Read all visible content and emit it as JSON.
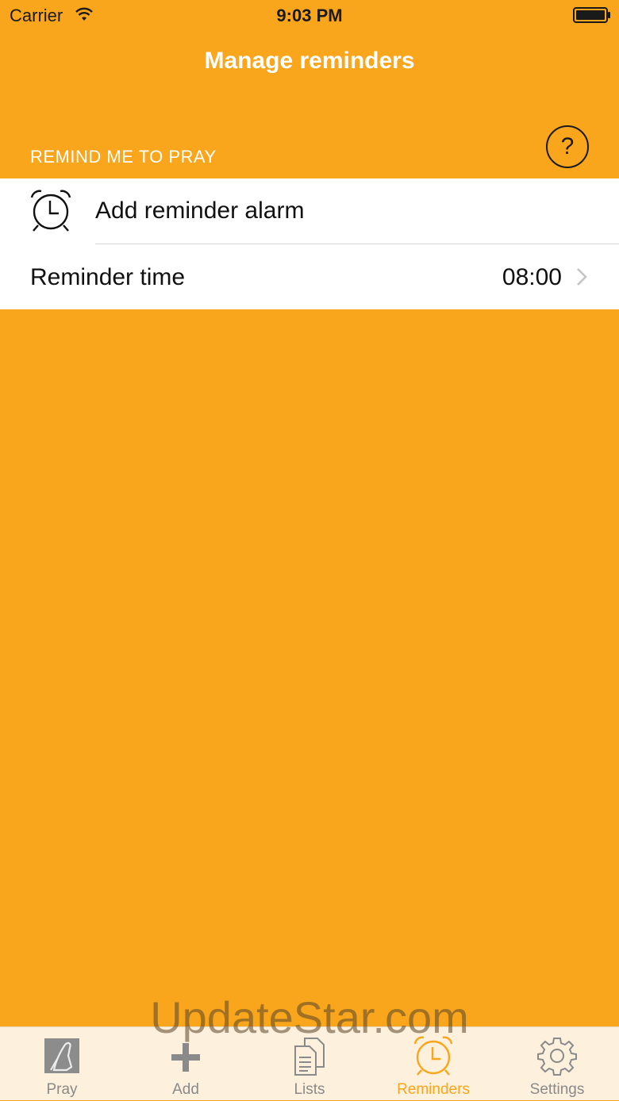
{
  "status_bar": {
    "carrier": "Carrier",
    "time": "9:03 PM"
  },
  "nav": {
    "title": "Manage reminders"
  },
  "section": {
    "header": "REMIND ME TO PRAY",
    "help_label": "?"
  },
  "rows": {
    "add_alarm_label": "Add reminder alarm",
    "reminder_time_label": "Reminder time",
    "reminder_time_value": "08:00"
  },
  "tabs": [
    {
      "label": "Pray",
      "icon": "praying-hands-icon"
    },
    {
      "label": "Add",
      "icon": "plus-icon"
    },
    {
      "label": "Lists",
      "icon": "documents-icon"
    },
    {
      "label": "Reminders",
      "icon": "alarm-clock-icon"
    },
    {
      "label": "Settings",
      "icon": "gear-icon"
    }
  ],
  "active_tab": "Reminders",
  "watermark": "UpdateStar.com",
  "colors": {
    "background": "#F9A61D",
    "tab_bar": "#FDF0DC",
    "tab_active": "#F9A61D",
    "tab_inactive": "#8a8a8a"
  }
}
